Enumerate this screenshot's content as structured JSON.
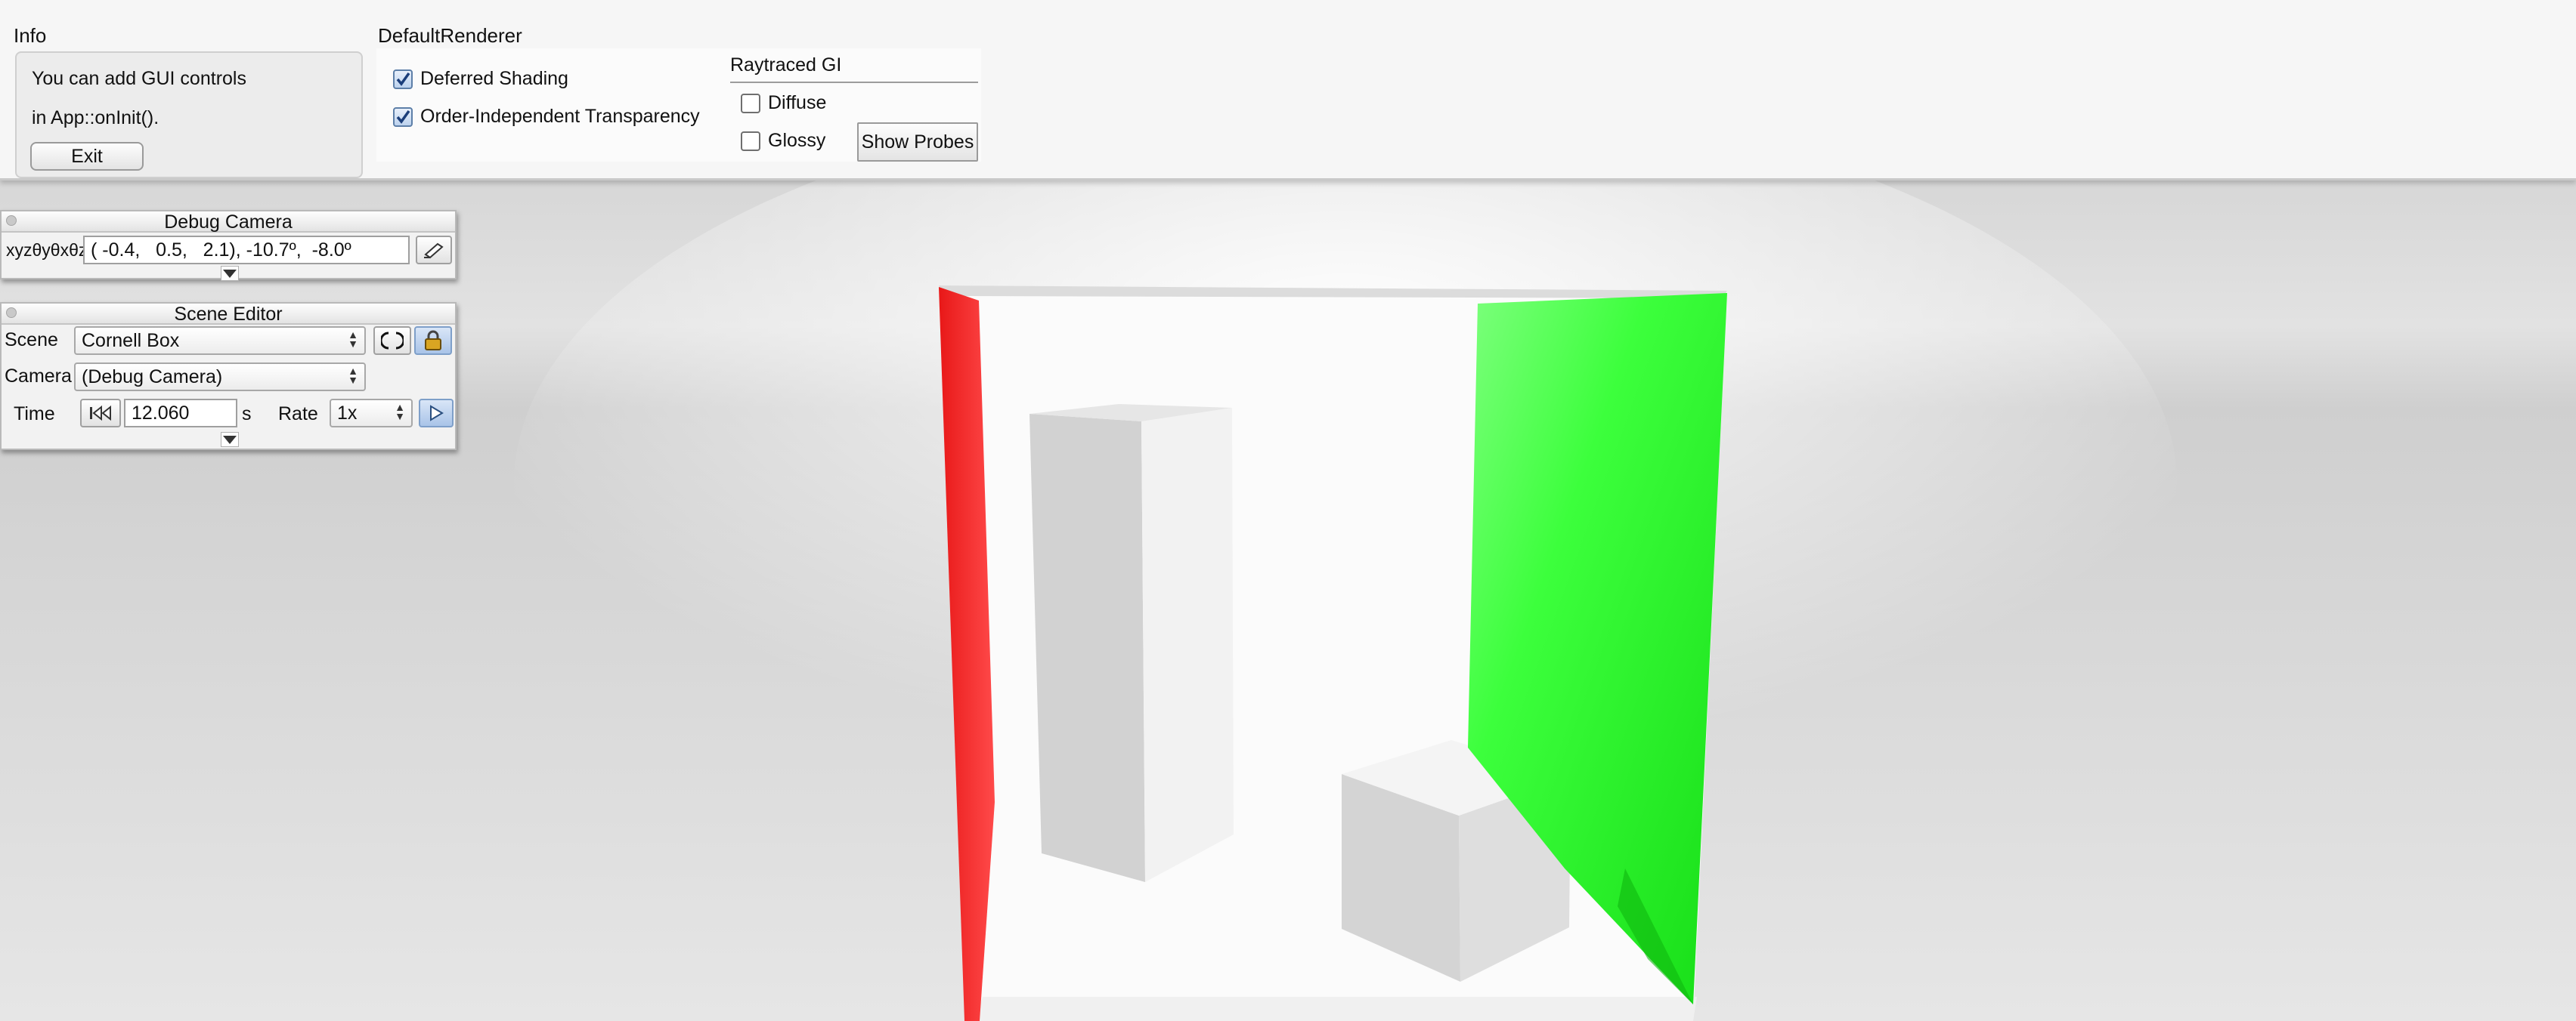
{
  "info": {
    "title": "Info",
    "line1": "You can add GUI controls",
    "line2": "in App::onInit().",
    "exit_label": "Exit"
  },
  "renderer": {
    "title": "DefaultRenderer",
    "deferred_shading": {
      "label": "Deferred Shading",
      "checked": true
    },
    "oit": {
      "label": "Order-Independent Transparency",
      "checked": true
    },
    "gi": {
      "title": "Raytraced GI",
      "diffuse": {
        "label": "Diffuse",
        "checked": false
      },
      "glossy": {
        "label": "Glossy",
        "checked": false
      },
      "show_probes_label": "Show Probes"
    }
  },
  "debug_camera": {
    "title": "Debug Camera",
    "coord_label": "xyzθyθxθz",
    "coord_value": "( -0.4,   0.5,   2.1), -10.7º,  -8.0º",
    "copy_icon": "edit-icon"
  },
  "scene_editor": {
    "title": "Scene Editor",
    "scene_label": "Scene",
    "scene_value": "Cornell Box",
    "camera_label": "Camera",
    "camera_value": "(Debug Camera)",
    "time_label": "Time",
    "time_value": "12.060",
    "time_unit": "s",
    "rate_label": "Rate",
    "rate_value": "1x",
    "reload_icon": "reload-icon",
    "lock_icon": "lock-icon",
    "rewind_icon": "rewind-icon",
    "play_icon": "play-icon"
  },
  "scene_colors": {
    "red_wall": "#ff2020",
    "green_wall": "#22ee22",
    "box": "#d8d8d8",
    "floor": "#f8f8f8"
  }
}
